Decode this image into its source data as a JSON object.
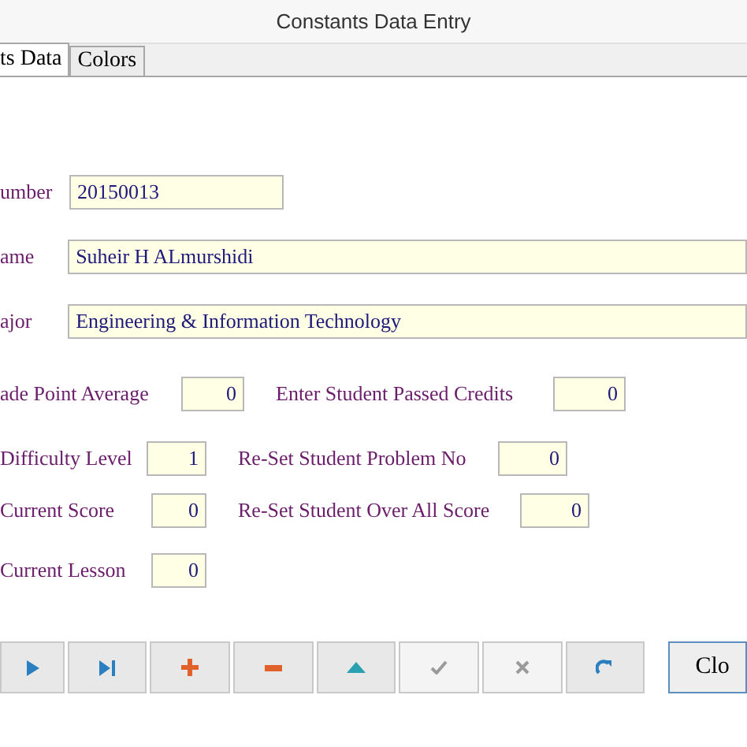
{
  "window": {
    "title": "Constants Data Entry"
  },
  "tabs": [
    {
      "label": "ts Data",
      "selected": true
    },
    {
      "label": "Colors",
      "selected": false
    }
  ],
  "wide_fields": [
    {
      "label": "umber",
      "value": "20150013",
      "kind": "short"
    },
    {
      "label": "ame",
      "value": "Suheir H ALmurshidi",
      "kind": "long"
    },
    {
      "label": "ajor",
      "value": "Engineering & Information Technology",
      "kind": "long"
    }
  ],
  "number_rows": [
    {
      "left": {
        "label": "ade Point Average",
        "value": "0"
      },
      "right": {
        "label": "Enter Student Passed Credits",
        "value": "0"
      }
    },
    {
      "left": {
        "label": "Difficulty Level",
        "value": "1"
      },
      "right": {
        "label": "Re-Set Student Problem No",
        "value": "0"
      }
    },
    {
      "left": {
        "label": "Current Score",
        "value": "0"
      },
      "right": {
        "label": "Re-Set Student Over All Score",
        "value": "0"
      }
    },
    {
      "left": {
        "label": "Current Lesson",
        "value": "0"
      }
    }
  ],
  "nav_buttons": [
    {
      "kind": "next",
      "disabled": false
    },
    {
      "kind": "last",
      "disabled": false
    },
    {
      "kind": "add",
      "disabled": false
    },
    {
      "kind": "delete",
      "disabled": false
    },
    {
      "kind": "edit",
      "disabled": false
    },
    {
      "kind": "post",
      "disabled": true
    },
    {
      "kind": "cancel",
      "disabled": true
    },
    {
      "kind": "refresh",
      "disabled": false
    }
  ],
  "close_button": {
    "label": "Clo"
  }
}
